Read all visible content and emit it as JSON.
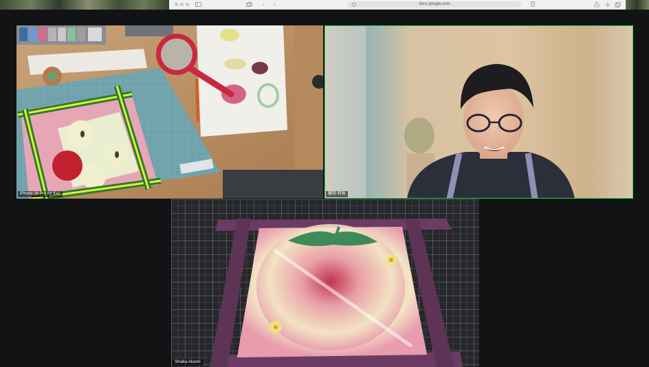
{
  "browser": {
    "url": "docs.google.com",
    "nav_back": "‹",
    "nav_forward": "›"
  },
  "participants": [
    {
      "name": "iPhone 16 Pro for Kaz",
      "active_speaker": false
    },
    {
      "name": "藤田 和秋",
      "active_speaker": true
    },
    {
      "name": "Shiaka Akashi",
      "active_speaker": false
    }
  ],
  "colors": {
    "app_background": "#121315",
    "active_speaker_border": "#2fd64f",
    "name_label_background": "#000000"
  },
  "icons": [
    "sidebar-icon",
    "tabs-icon",
    "shield-icon",
    "share-icon",
    "new-tab-icon",
    "tab-overview-icon"
  ]
}
